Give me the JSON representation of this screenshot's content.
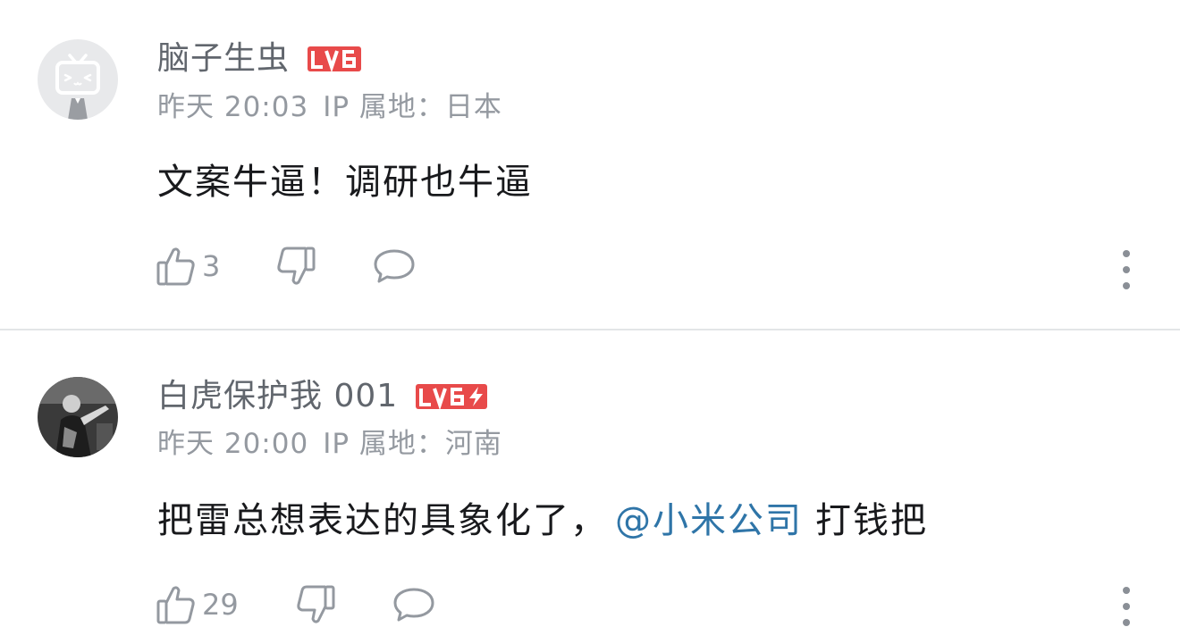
{
  "comments": [
    {
      "username": "脑子生虫",
      "level": "LV6",
      "time": "昨天 20:03",
      "ip": "IP 属地：日本",
      "text": "文案牛逼！调研也牛逼",
      "likes": "3",
      "avatar_icon": "bilibili-tv-default-avatar-icon"
    },
    {
      "username": "白虎保护我 001",
      "level": "LV6",
      "level_badge": "lightning-icon",
      "time": "昨天 20:00",
      "ip": "IP 属地：河南",
      "text_before": "把雷总想表达的具象化了，",
      "mention": "@小米公司",
      "text_after": "打钱把",
      "likes": "29",
      "avatar_icon": "photo-avatar-icon"
    }
  ],
  "colors": {
    "level_red": "#e84a4a",
    "mention_blue": "#2f75a8",
    "meta_gray": "#9499a0",
    "username_gray": "#61666d",
    "divider": "#e3e5e7"
  }
}
